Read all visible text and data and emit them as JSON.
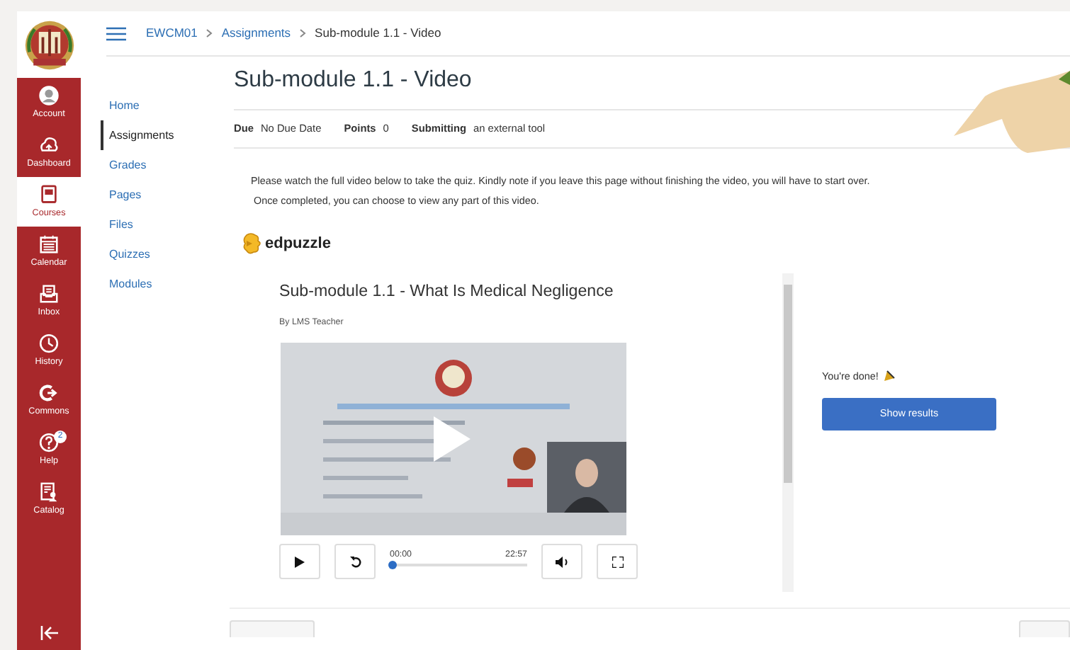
{
  "global_nav": [
    {
      "kind": "account",
      "label": "Account",
      "selected": false
    },
    {
      "kind": "dashboard",
      "label": "Dashboard",
      "selected": false
    },
    {
      "kind": "courses",
      "label": "Courses",
      "selected": true
    },
    {
      "kind": "calendar",
      "label": "Calendar",
      "selected": false
    },
    {
      "kind": "inbox",
      "label": "Inbox",
      "selected": false
    },
    {
      "kind": "history",
      "label": "History",
      "selected": false
    },
    {
      "kind": "commons",
      "label": "Commons",
      "selected": false
    },
    {
      "kind": "help",
      "label": "Help",
      "selected": false,
      "badge": "2"
    },
    {
      "kind": "catalog",
      "label": "Catalog",
      "selected": false
    }
  ],
  "breadcrumb": [
    "EWCM01",
    "Assignments",
    "Sub-module 1.1 - Video"
  ],
  "course_nav": [
    {
      "label": "Home",
      "selected": false
    },
    {
      "label": "Assignments",
      "selected": true
    },
    {
      "label": "Grades",
      "selected": false
    },
    {
      "label": "Pages",
      "selected": false
    },
    {
      "label": "Files",
      "selected": false
    },
    {
      "label": "Quizzes",
      "selected": false
    },
    {
      "label": "Modules",
      "selected": false
    }
  ],
  "assignment": {
    "title": "Sub-module 1.1 - Video",
    "details": [
      {
        "label": "Due",
        "value": "No Due Date"
      },
      {
        "label": "Points",
        "value": "0"
      },
      {
        "label": "Submitting",
        "value": "an external tool"
      }
    ],
    "instructions": [
      "Please watch the full video below to take the quiz.  Kindly note if you leave this page without finishing the video, you will have to start over.",
      "Once completed, you can choose to view any part of this video."
    ]
  },
  "embed": {
    "brand": "edpuzzle",
    "video_title": "Sub-module 1.1 - What Is Medical Negligence",
    "author": "By LMS Teacher",
    "player": {
      "time_current": "00:00",
      "time_total": "22:57",
      "level": 0
    },
    "completion_text": "You're done!",
    "results_button": "Show results"
  }
}
